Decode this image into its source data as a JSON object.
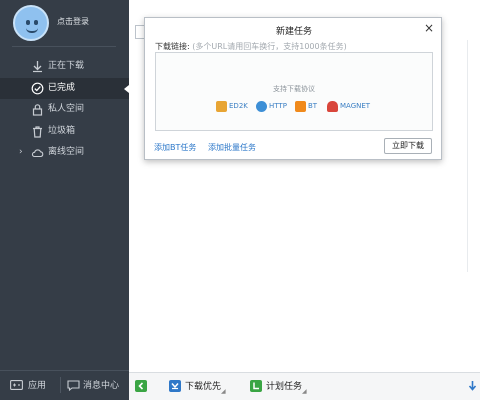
{
  "sidebar": {
    "login_text": "点击登录",
    "items": [
      {
        "label": "正在下载",
        "icon": "download-arrow-icon"
      },
      {
        "label": "已完成",
        "icon": "check-circle-icon",
        "active": true
      },
      {
        "label": "私人空间",
        "icon": "lock-icon"
      },
      {
        "label": "垃圾箱",
        "icon": "trash-icon"
      },
      {
        "label": "离线空间",
        "icon": "cloud-icon",
        "expandable": true
      }
    ],
    "bottom": {
      "apps_label": "应用",
      "messages_label": "消息中心"
    }
  },
  "dialog": {
    "title": "新建任务",
    "close": "×",
    "url_label": "下载链接:",
    "url_hint": "(多个URL请用回车换行，支持1000条任务)",
    "support_text": "支持下载协议",
    "protocols": [
      {
        "label": "ED2K",
        "color": "#e8a534"
      },
      {
        "label": "HTTP",
        "color": "#3d8fd6"
      },
      {
        "label": "BT",
        "color": "#f08a1c"
      },
      {
        "label": "MAGNET",
        "color": "#d9463b"
      }
    ],
    "add_bt_label": "添加BT任务",
    "add_batch_label": "添加批量任务",
    "download_now_label": "立即下载"
  },
  "statusbar": {
    "download_priority_label": "下载优先",
    "schedule_label": "计划任务"
  },
  "colors": {
    "sidebar_bg": "#353d47",
    "sidebar_active": "#2a3038",
    "link_blue": "#2b77c9",
    "status_green": "#3aa544"
  }
}
